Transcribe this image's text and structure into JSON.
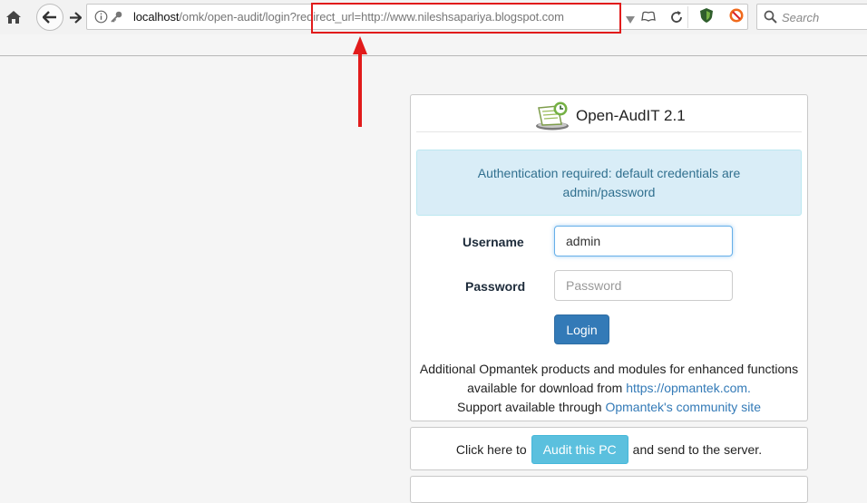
{
  "browser": {
    "url_host": "localhost",
    "url_path": "/omk/open-audit/login?redirect_url=http://www.nileshsapariya.blogspot.com",
    "search_placeholder": "Search"
  },
  "login": {
    "app_title": "Open-AudIT 2.1",
    "alert_line1": "Authentication required: default credentials are",
    "alert_line2": "admin/password",
    "username_label": "Username",
    "username_value": "admin",
    "password_label": "Password",
    "password_placeholder": "Password",
    "login_label": "Login",
    "info_line1": "Additional Opmantek products and modules for enhanced functions",
    "info_line2_prefix": "available for download from",
    "info_link1": "https://opmantek.com.",
    "info_line3_prefix": "Support available through",
    "info_link2": "Opmantek's community site"
  },
  "audit": {
    "prefix": "Click here to",
    "button_label": "Audit this PC",
    "suffix": "and send to the server."
  },
  "colors": {
    "annotation": "#e11b1b",
    "primary_button": "#337ab7",
    "info_button": "#5bc0de",
    "alert_bg": "#d9edf7"
  }
}
